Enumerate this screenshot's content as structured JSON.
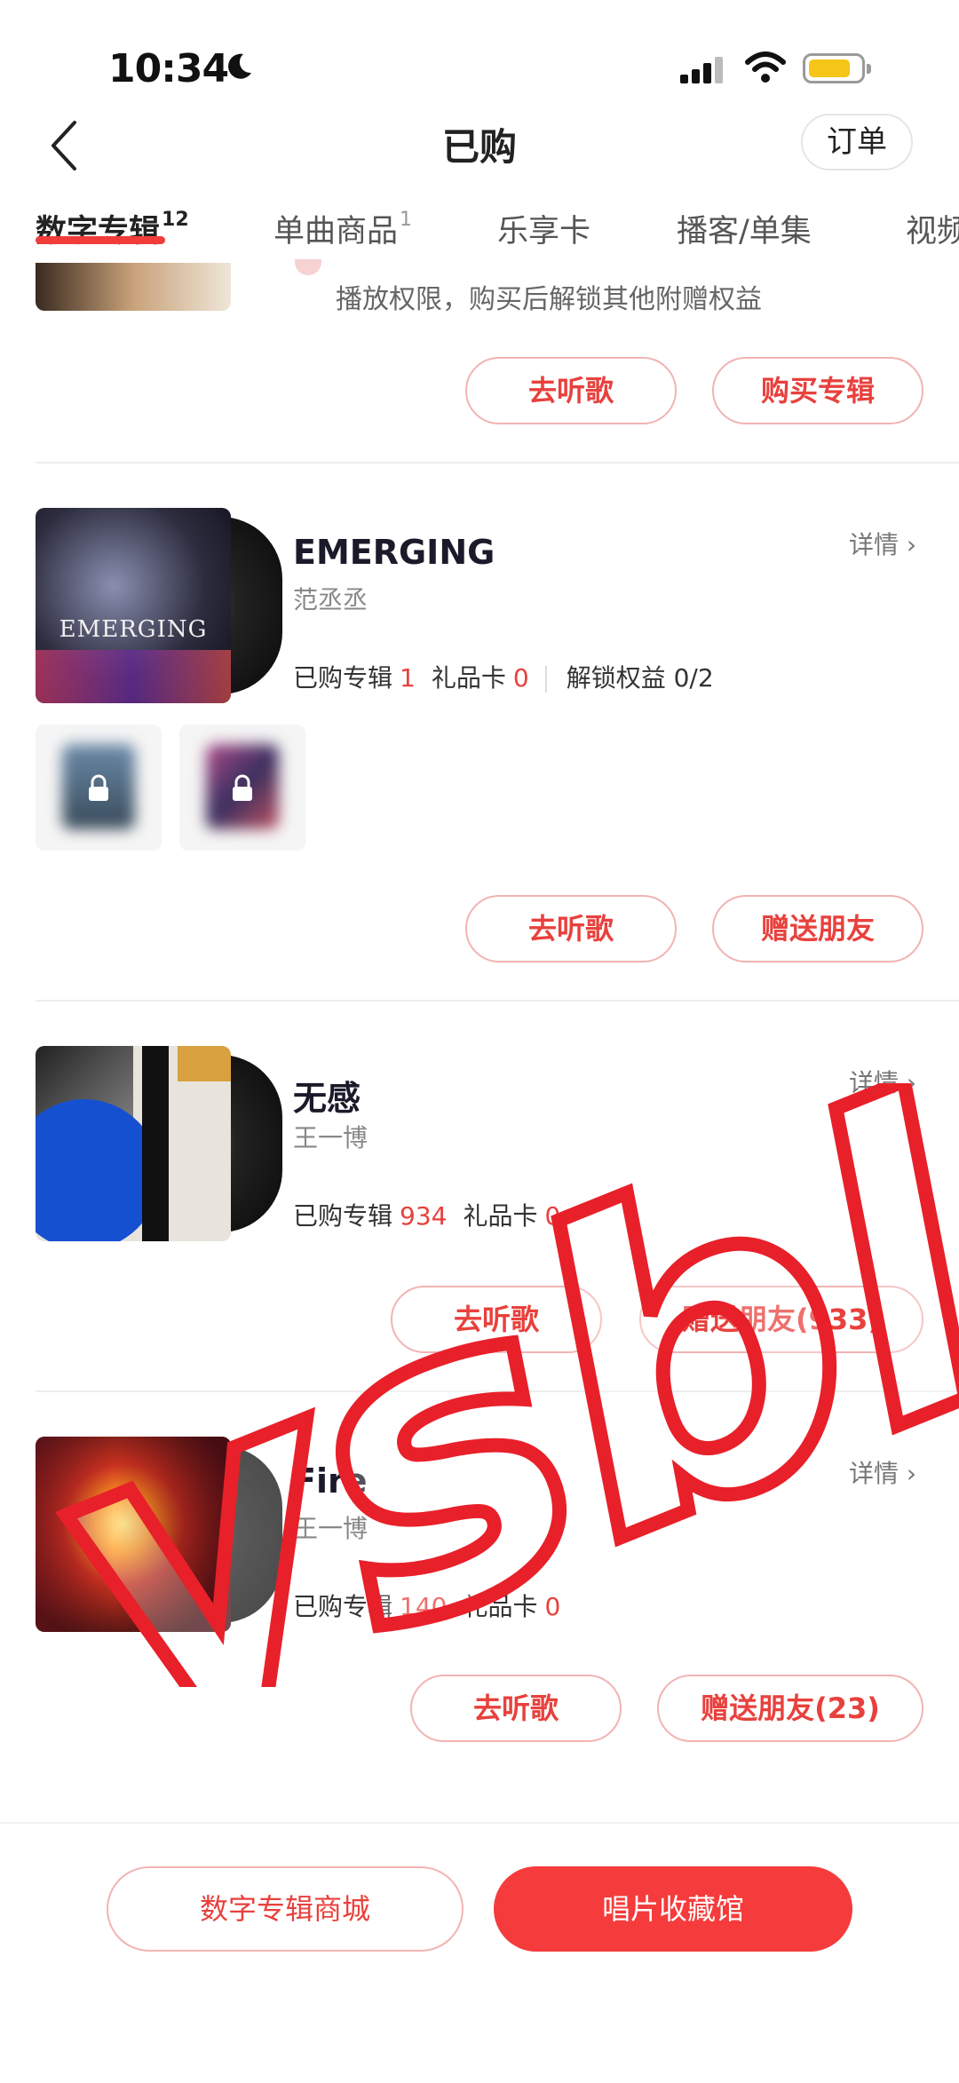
{
  "status_bar": {
    "time": "10:34"
  },
  "header": {
    "title": "已购",
    "order_label": "订单"
  },
  "tabs": [
    {
      "label": "数字专辑",
      "count": "12"
    },
    {
      "label": "单曲商品",
      "count": "1"
    },
    {
      "label": "乐享卡"
    },
    {
      "label": "播客/单集"
    },
    {
      "label": "视频"
    }
  ],
  "partial_card": {
    "desc": "播放权限，购买后解锁其他附赠权益",
    "buttons": [
      "去听歌",
      "购买专辑"
    ]
  },
  "albums": [
    {
      "title": "EMERGING",
      "artist": "范丞丞",
      "detail": "详情",
      "stats": {
        "purchased_label": "已购专辑",
        "purchased": "1",
        "gift_label": "礼品卡",
        "gift": "0",
        "unlock": "解锁权益 0/2"
      },
      "buttons": [
        "去听歌",
        "赠送朋友"
      ]
    },
    {
      "title": "无感",
      "artist": "王一博",
      "detail": "详情",
      "stats": {
        "purchased_label": "已购专辑",
        "purchased": "934",
        "gift_label": "礼品卡",
        "gift": "0"
      },
      "buttons": [
        "去听歌",
        "赠送朋友(933)"
      ]
    },
    {
      "title": "Fire",
      "artist": "王一博",
      "detail": "详情",
      "stats": {
        "purchased_label": "已购专辑",
        "purchased": "140",
        "gift_label": "礼品卡",
        "gift": "0"
      },
      "buttons": [
        "去听歌",
        "赠送朋友(23)"
      ]
    }
  ],
  "bottom": {
    "mall": "数字专辑商城",
    "vinyl": "唱片收藏馆"
  },
  "watermark": "ysbl",
  "colors": {
    "accent": "#e8413d",
    "primary_button": "#f53b3b",
    "battery": "#f5c518"
  }
}
